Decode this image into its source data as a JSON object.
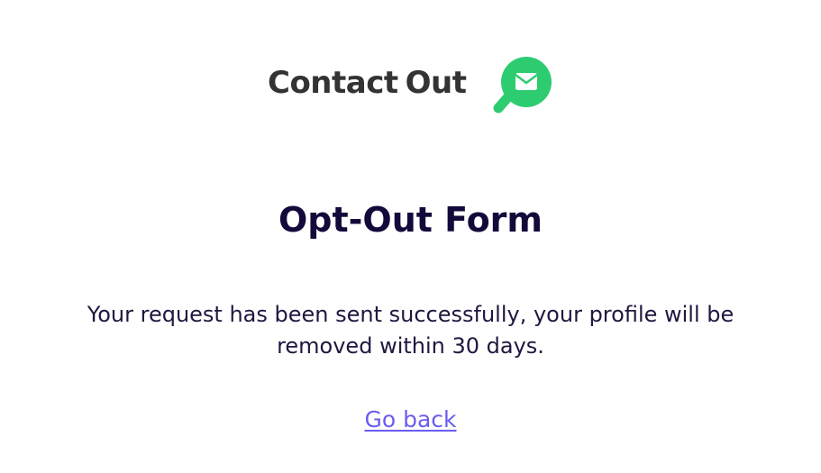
{
  "logo": {
    "word_1": "Contact",
    "word_2": "Out",
    "mark_icon": "magnifier-envelope-icon",
    "brand_color": "#2ecc71",
    "text_color": "#333333"
  },
  "page": {
    "title": "Opt-Out Form",
    "message": "Your request has been sent successfully, your profile will be removed within 30 days.",
    "back_link_label": "Go back",
    "title_color": "#14093a",
    "link_color": "#6a5cf2"
  }
}
